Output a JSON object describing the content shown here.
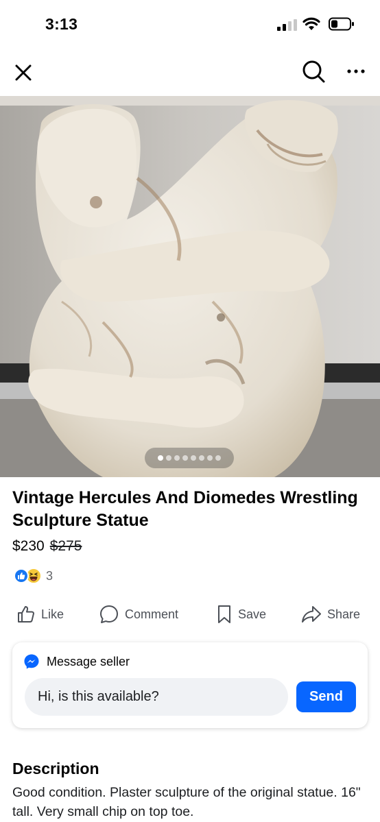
{
  "status": {
    "time": "3:13"
  },
  "nav": {
    "close_icon": "close-icon",
    "search_icon": "search-icon",
    "more_icon": "more-icon"
  },
  "photo": {
    "alt": "Vintage Hercules And Diomedes Wrestling Sculpture Statue",
    "image_count": 8,
    "active_index": 0
  },
  "listing": {
    "title": "Vintage Hercules And Diomedes Wrestling Sculpture Statue",
    "price": "$230",
    "original_price": "$275",
    "reaction_count": "3"
  },
  "actions": {
    "like": "Like",
    "comment": "Comment",
    "save": "Save",
    "share": "Share"
  },
  "message": {
    "header": "Message seller",
    "input_value": "Hi, is this available?",
    "send": "Send"
  },
  "description": {
    "title": "Description",
    "text": "Good condition. Plaster sculpture of the original statue. 16\" tall. Very small chip on top toe."
  },
  "colors": {
    "accent": "#0866ff",
    "like_blue": "#1877f2",
    "text_secondary": "#65676b"
  }
}
